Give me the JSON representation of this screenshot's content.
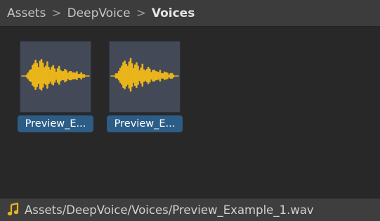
{
  "breadcrumb": {
    "items": [
      "Assets",
      "DeepVoice",
      "Voices"
    ],
    "separator": ">"
  },
  "assets": [
    {
      "label": "Preview_E...",
      "icon": "audio-waveform-icon"
    },
    {
      "label": "Preview_E...",
      "icon": "audio-waveform-icon"
    }
  ],
  "status": {
    "icon": "music-note-icon",
    "path": "Assets/DeepVoice/Voices/Preview_Example_1.wav"
  },
  "colors": {
    "waveform": "#e9b51a",
    "selection": "#2c5d87",
    "thumbnail_bg": "#434957"
  }
}
